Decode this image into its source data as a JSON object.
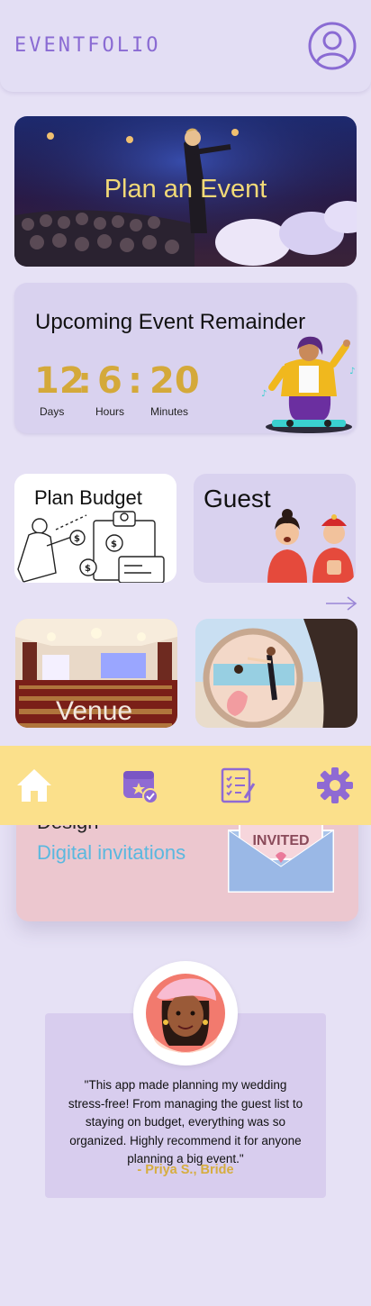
{
  "header": {
    "brand": "EVENTFOLIO"
  },
  "hero": {
    "title": "Plan an Event"
  },
  "reminder": {
    "title": "Upcoming Event Remainder",
    "countdown": [
      {
        "value": "12",
        "unit": "Days"
      },
      {
        "value": "6",
        "unit": "Hours"
      },
      {
        "value": "20",
        "unit": "Minutes"
      }
    ],
    "separator": ":"
  },
  "tiles": {
    "budget": "Plan Budget",
    "guest": "Guest",
    "venue": "Venue"
  },
  "invitations": {
    "title": "Design",
    "subtitle": "Digital invitations",
    "badge": "INVITED"
  },
  "testimonial": {
    "quote": "\"This app made planning my wedding stress-free! From managing the guest list to staying on budget, everything was so organized. Highly recommend it for anyone planning a big event.\"",
    "author": "- Priya S., Bride"
  },
  "colors": {
    "brand": "#8a6bd3",
    "accent_gold": "#d4a93a",
    "tabbar": "#fbe08b",
    "invite_link": "#5ab8df"
  },
  "icons": {
    "profile": "user-circle-icon",
    "home": "home-icon",
    "events": "calendar-star-icon",
    "tasks": "checklist-icon",
    "settings": "gear-icon",
    "next": "arrow-right-icon"
  }
}
